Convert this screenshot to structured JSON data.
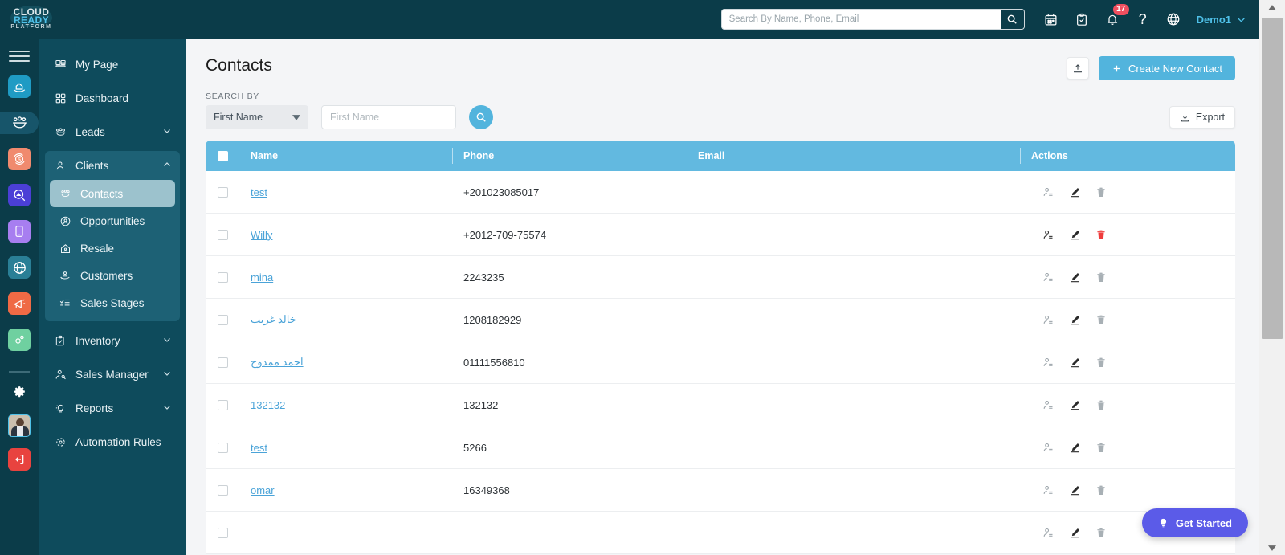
{
  "brand": {
    "logo_line1": "CLOUD",
    "logo_line2": "READY",
    "logo_line3": "PLATFORM",
    "accent": "#4fc1e9",
    "topbar_bg": "#0b3c49",
    "sidebar_bg": "#0e4b5c",
    "table_header_bg": "#62b9e0",
    "primary_btn_bg": "#52b4dd",
    "danger": "#e8433f",
    "get_started_bg": "#5b5be8"
  },
  "topbar": {
    "search": {
      "placeholder": "Search By Name, Phone, Email",
      "value": "",
      "button_icon": "search-icon"
    },
    "icons": [
      {
        "name": "calendar-icon"
      },
      {
        "name": "clipboard-check-icon"
      },
      {
        "name": "bell-icon",
        "badge": "17"
      },
      {
        "name": "help-question-icon"
      },
      {
        "name": "globe-language-icon"
      }
    ],
    "user": {
      "label": "Demo1",
      "chevron": "chevron-down-icon"
    }
  },
  "rail": {
    "menu_icon": "hamburger-menu-icon",
    "items": [
      {
        "name": "property-handover-icon",
        "color": "#1f9bc4",
        "active": false
      },
      {
        "name": "team-group-icon",
        "color": "#0e4b5c",
        "active": true
      },
      {
        "name": "resale-refresh-dollar-icon",
        "color": "#f08a6e",
        "active": false
      },
      {
        "name": "search-property-icon",
        "color": "#4b3fd6",
        "active": false
      },
      {
        "name": "mobile-app-icon",
        "color": "#a77ef0",
        "active": false
      },
      {
        "name": "globe-web-icon",
        "color": "#2a7f96",
        "active": false
      },
      {
        "name": "megaphone-marketing-icon",
        "color": "#ef6a45",
        "active": false
      },
      {
        "name": "settings-gears-icon",
        "color": "#6fd0a0",
        "active": false
      }
    ],
    "gear": "settings-gear-icon",
    "avatar": "user-avatar",
    "logout": "logout-icon"
  },
  "sidebar": {
    "items": [
      {
        "label": "My Page",
        "icon": "my-page-icon",
        "expandable": false
      },
      {
        "label": "Dashboard",
        "icon": "dashboard-grid-icon",
        "expandable": false
      },
      {
        "label": "Leads",
        "icon": "leads-group-icon",
        "expandable": true,
        "expanded": false,
        "chevron": "chevron-down-icon"
      },
      {
        "label": "Clients",
        "icon": "client-person-icon",
        "expandable": true,
        "expanded": true,
        "chevron": "chevron-up-icon",
        "children": [
          {
            "label": "Contacts",
            "icon": "contacts-group-icon",
            "selected": true
          },
          {
            "label": "Opportunities",
            "icon": "opportunity-target-icon",
            "selected": false
          },
          {
            "label": "Resale",
            "icon": "resale-house-icon",
            "selected": false
          },
          {
            "label": "Customers",
            "icon": "customers-hand-icon",
            "selected": false
          },
          {
            "label": "Sales Stages",
            "icon": "sales-stages-list-icon",
            "selected": false
          }
        ]
      },
      {
        "label": "Inventory",
        "icon": "inventory-clipboard-icon",
        "expandable": true,
        "expanded": false,
        "chevron": "chevron-down-icon"
      },
      {
        "label": "Sales Manager",
        "icon": "sales-manager-person-icon",
        "expandable": true,
        "expanded": false,
        "chevron": "chevron-down-icon"
      },
      {
        "label": "Reports",
        "icon": "reports-bulb-icon",
        "expandable": true,
        "expanded": false,
        "chevron": "chevron-down-icon"
      },
      {
        "label": "Automation Rules",
        "icon": "automation-rules-icon",
        "expandable": false
      }
    ]
  },
  "page": {
    "title": "Contacts",
    "upload_button": {
      "name": "upload-icon",
      "label": ""
    },
    "create_button": {
      "label": "Create New Contact",
      "icon": "plus-icon"
    },
    "search_by_label": "SEARCH BY",
    "field_select": {
      "value": "First Name",
      "caret": "caret-down-icon"
    },
    "field_input": {
      "placeholder": "First Name",
      "value": ""
    },
    "search_button": {
      "name": "search-icon"
    },
    "export_button": {
      "label": "Export",
      "icon": "download-icon"
    }
  },
  "table": {
    "columns": [
      "Name",
      "Phone",
      "Email",
      "Actions"
    ],
    "header_checkbox_checked": false,
    "row_actions": [
      "convert-contact-icon",
      "edit-pencil-icon",
      "delete-trash-icon"
    ],
    "rows": [
      {
        "checked": false,
        "name": "test",
        "phone": "+201023085017",
        "email": "",
        "delete_highlighted": false
      },
      {
        "checked": false,
        "name": "Willy",
        "phone": "+2012-709-75574",
        "email": "",
        "delete_highlighted": true
      },
      {
        "checked": false,
        "name": "mina",
        "phone": "2243235",
        "email": "",
        "delete_highlighted": false
      },
      {
        "checked": false,
        "name": "خالد غريب",
        "phone": "1208182929",
        "email": "",
        "delete_highlighted": false
      },
      {
        "checked": false,
        "name": "احمد ممدوح",
        "phone": "01111556810",
        "email": "",
        "delete_highlighted": false
      },
      {
        "checked": false,
        "name": "132132",
        "phone": "132132",
        "email": "",
        "delete_highlighted": false
      },
      {
        "checked": false,
        "name": "test",
        "phone": "5266",
        "email": "",
        "delete_highlighted": false
      },
      {
        "checked": false,
        "name": "omar",
        "phone": "16349368",
        "email": "",
        "delete_highlighted": false
      },
      {
        "checked": false,
        "name": "",
        "phone": "",
        "email": "",
        "delete_highlighted": false
      }
    ]
  },
  "get_started": {
    "label": "Get Started",
    "icon": "lightbulb-icon"
  },
  "scrollbar": {
    "up": "scroll-up-arrow-icon",
    "down": "scroll-down-arrow-icon"
  }
}
